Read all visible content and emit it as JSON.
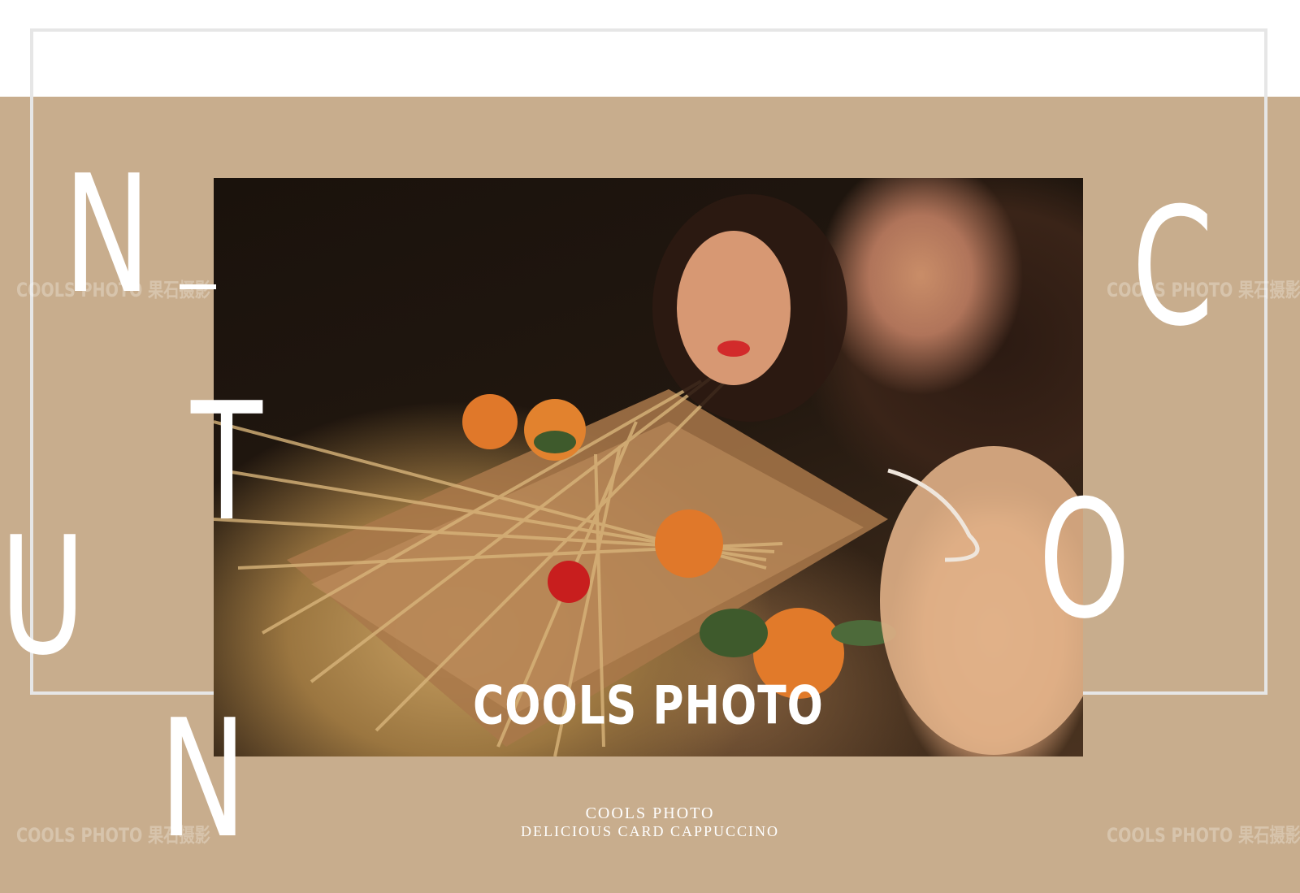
{
  "photo": {
    "caption": "COOLS PHOTO"
  },
  "letters": {
    "n_top": "N",
    "t": "T",
    "u": "U",
    "n_bottom": "N",
    "c": "C",
    "o": "O"
  },
  "watermarks": {
    "text": "COOLS PHOTO 果石摄影"
  },
  "footer": {
    "line1": "COOLS  PHOTO",
    "line2": "DELICIOUS  CARD  CAPPUCCINO"
  },
  "colors": {
    "tan": "#c8ad8d",
    "frame": "#e6e6e6",
    "text": "#ffffff"
  }
}
